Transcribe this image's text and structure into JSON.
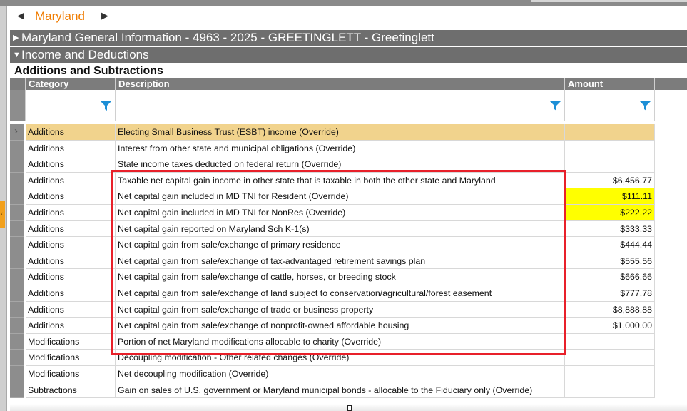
{
  "nav": {
    "state": "Maryland",
    "prev_icon": "left-triangle-icon",
    "next_icon": "right-triangle-icon"
  },
  "sections": {
    "general_info": "Maryland General Information - 4963 - 2025 - GREETINGLETT - Greetinglett",
    "income": "Income and Deductions"
  },
  "subsection": "Additions and Subtractions",
  "columns": {
    "category": "Category",
    "description": "Description",
    "amount": "Amount"
  },
  "colors": {
    "section_band": "#6e6e6e",
    "selected_row": "#f1d38d",
    "override_amount": "#ffff00",
    "annotation_box": "#e8202a",
    "state_label": "#f07c00"
  },
  "rows": [
    {
      "category": "Additions",
      "description": "Electing Small Business Trust (ESBT) income (Override)",
      "amount": ""
    },
    {
      "category": "Additions",
      "description": "Interest from other state and municipal obligations (Override)",
      "amount": ""
    },
    {
      "category": "Additions",
      "description": "State income taxes deducted on federal return (Override)",
      "amount": ""
    },
    {
      "category": "Additions",
      "description": "Taxable net capital gain income in other state that is taxable in both the other state and Maryland",
      "amount": "$6,456.77"
    },
    {
      "category": "Additions",
      "description": "Net capital gain included in MD TNI for Resident (Override)",
      "amount": "$111.11"
    },
    {
      "category": "Additions",
      "description": "Net capital gain included in MD TNI for NonRes (Override)",
      "amount": "$222.22"
    },
    {
      "category": "Additions",
      "description": "Net capital gain reported on Maryland Sch K-1(s)",
      "amount": "$333.33"
    },
    {
      "category": "Additions",
      "description": "Net capital gain from sale/exchange of primary residence",
      "amount": "$444.44"
    },
    {
      "category": "Additions",
      "description": "Net capital gain from sale/exchange of tax-advantaged retirement savings plan",
      "amount": "$555.56"
    },
    {
      "category": "Additions",
      "description": "Net capital gain from sale/exchange of cattle, horses, or breeding stock",
      "amount": "$666.66"
    },
    {
      "category": "Additions",
      "description": "Net capital gain from sale/exchange of land subject to conservation/agricultural/forest easement",
      "amount": "$777.78"
    },
    {
      "category": "Additions",
      "description": "Net capital gain from sale/exchange of trade or business property",
      "amount": "$8,888.88"
    },
    {
      "category": "Additions",
      "description": "Net capital gain from sale/exchange of nonprofit-owned affordable housing",
      "amount": "$1,000.00"
    },
    {
      "category": "Modifications",
      "description": "Portion of net Maryland modifications allocable to charity (Override)",
      "amount": ""
    },
    {
      "category": "Modifications",
      "description": "Decoupling modification - Other related changes (Override)",
      "amount": ""
    },
    {
      "category": "Modifications",
      "description": "Net decoupling modification (Override)",
      "amount": ""
    },
    {
      "category": "Subtractions",
      "description": "Gain on sales of U.S. government or Maryland municipal bonds - allocable to the Fiduciary only (Override)",
      "amount": ""
    }
  ]
}
